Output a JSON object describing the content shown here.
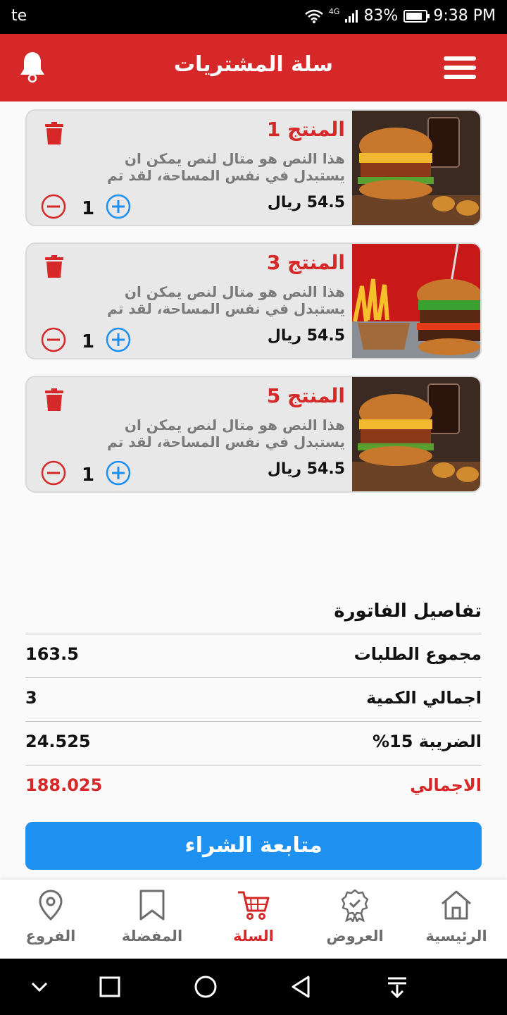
{
  "status_bar": {
    "carrier": "te",
    "network": "4G",
    "battery": "83%",
    "battery_level": 0.83,
    "time": "9:38 PM"
  },
  "header": {
    "title": "سلة المشتريات"
  },
  "cart_items": [
    {
      "name": "المنتج 1",
      "desc_line1": "هذا النص هو متال لنص يمكن ان",
      "desc_line2": "يستبدل في نفس المساحة، لقد تم",
      "price": "54.5 ريال",
      "qty": "1"
    },
    {
      "name": "المنتج 3",
      "desc_line1": "هذا النص هو متال لنص يمكن ان",
      "desc_line2": "يستبدل في نفس المساحة، لقد تم",
      "price": "54.5 ريال",
      "qty": "1"
    },
    {
      "name": "المنتج 5",
      "desc_line1": "هذا النص هو متال لنص يمكن ان",
      "desc_line2": "يستبدل في نفس المساحة، لقد تم",
      "price": "54.5 ريال",
      "qty": "1"
    }
  ],
  "invoice": {
    "title": "تفاصيل الفاتورة",
    "rows": [
      {
        "label": "مجموع الطلبات",
        "value": "163.5"
      },
      {
        "label": "اجمالي الكمية",
        "value": "3"
      },
      {
        "label": "الضريبة 15%",
        "value": "24.525"
      },
      {
        "label": "الاجمالي",
        "value": "188.025"
      }
    ]
  },
  "checkout": {
    "label": "متابعة الشراء"
  },
  "bottom_nav": [
    {
      "label": "الفروع",
      "icon": "location-pin-icon"
    },
    {
      "label": "المفضلة",
      "icon": "bookmark-icon"
    },
    {
      "label": "السلة",
      "icon": "cart-icon",
      "active": true
    },
    {
      "label": "العروض",
      "icon": "badge-icon"
    },
    {
      "label": "الرئيسية",
      "icon": "home-icon"
    }
  ],
  "colors": {
    "primary": "#d62828",
    "accent": "#1e90f0",
    "card": "#e8e8e8"
  }
}
